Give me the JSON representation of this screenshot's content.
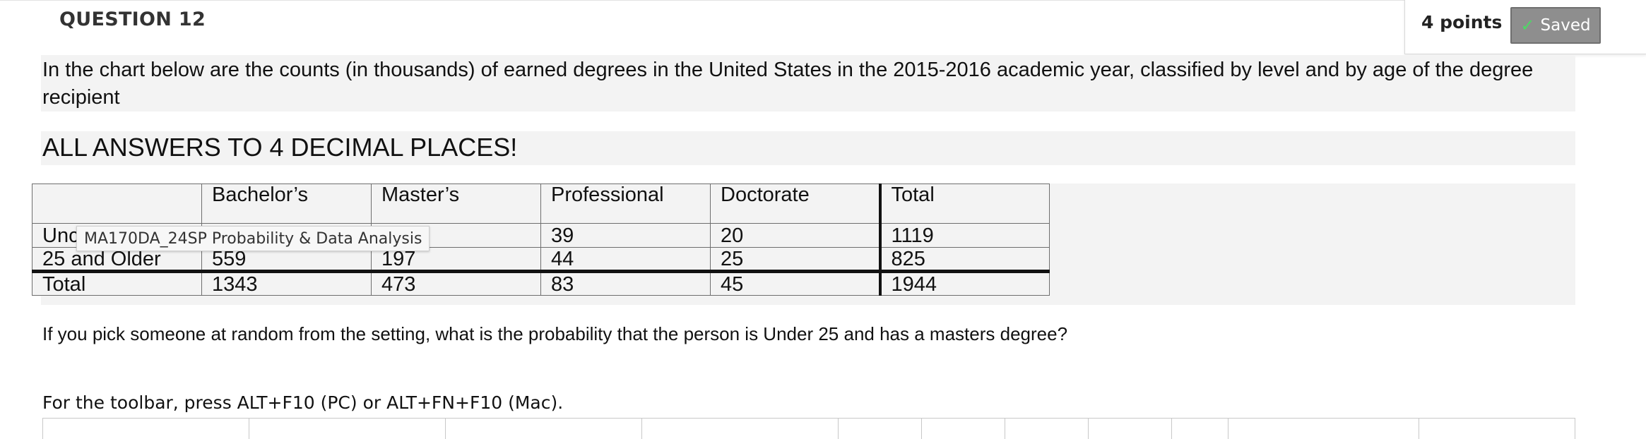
{
  "question": {
    "title": "QUESTION 12",
    "points": "4 points",
    "saved_label": "Saved",
    "intro": "In the chart below are the counts (in thousands) of earned degrees in the United States in the 2015-2016 academic year, classified by level and by age of the degree recipient",
    "caps_note": "ALL ANSWERS TO 4 DECIMAL PLACES!",
    "prompt": "If you pick someone at random from the setting, what is the probability that the person is Under 25 and has a masters degree?",
    "toolbar_hint": "For the toolbar, press ALT+F10 (PC) or ALT+FN+F10 (Mac)."
  },
  "table": {
    "headers": [
      "",
      "Bachelor’s",
      "Master’s",
      "Professional",
      "Doctorate",
      "Total"
    ],
    "rows": [
      [
        "Unc",
        "",
        "",
        "39",
        "20",
        "1119"
      ],
      [
        "25 and Older",
        "559",
        "197",
        "44",
        "25",
        "825"
      ],
      [
        "Total",
        "1343",
        "473",
        "83",
        "45",
        "1944"
      ]
    ]
  },
  "tooltip": "MA170DA_24SP Probability & Data Analysis",
  "icons": {
    "saved": "check-icon"
  },
  "colors": {
    "saved_bg": "#8e8e8e",
    "check": "#4cd964",
    "band": "#f3f3f3"
  }
}
